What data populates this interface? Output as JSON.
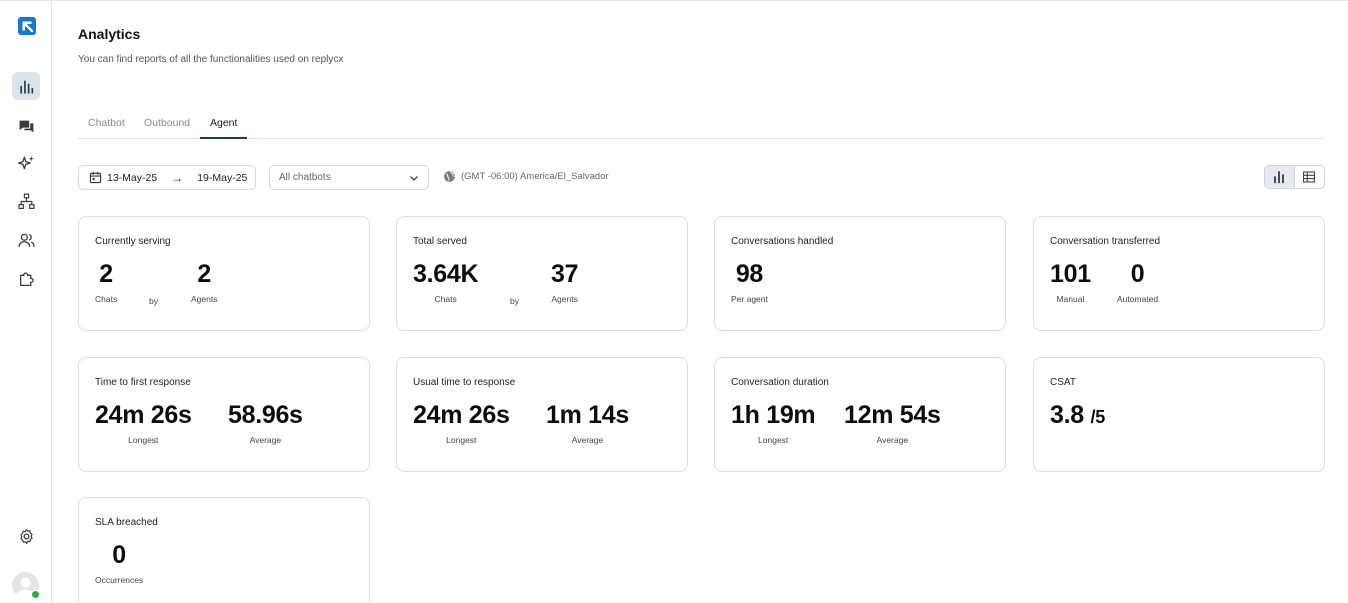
{
  "app": {
    "name": "replycx"
  },
  "sidebar": {
    "items": [
      {
        "name": "analytics",
        "icon": "bar-chart-icon",
        "active": true
      },
      {
        "name": "conversations",
        "icon": "chat-icon"
      },
      {
        "name": "ai",
        "icon": "sparkles-icon"
      },
      {
        "name": "flows",
        "icon": "sitemap-icon"
      },
      {
        "name": "users",
        "icon": "users-icon"
      },
      {
        "name": "integrations",
        "icon": "puzzle-icon"
      }
    ],
    "bottom": [
      {
        "name": "settings",
        "icon": "gear-icon"
      },
      {
        "name": "profile",
        "icon": "avatar-icon",
        "status": "online"
      }
    ]
  },
  "header": {
    "title": "Analytics",
    "subtitle": "You can find reports of all the functionalities used on replycx"
  },
  "tabs": [
    {
      "label": "Chatbot",
      "active": false
    },
    {
      "label": "Outbound",
      "active": false
    },
    {
      "label": "Agent",
      "active": true
    }
  ],
  "filters": {
    "date_from": "13-May-25",
    "date_to": "19-May-25",
    "chatbot_select": "All chatbots",
    "timezone": "(GMT -06:00) America/El_Salvador",
    "view_mode": "chart"
  },
  "cards": {
    "currently_serving": {
      "title": "Currently serving",
      "chats": "2",
      "chats_label": "Chats",
      "by": "by",
      "agents": "2",
      "agents_label": "Agents"
    },
    "total_served": {
      "title": "Total served",
      "chats": "3.64K",
      "chats_label": "Chats",
      "by": "by",
      "agents": "37",
      "agents_label": "Agents"
    },
    "conversations_handled": {
      "title": "Conversations handled",
      "value": "98",
      "label": "Per agent"
    },
    "conversation_transferred": {
      "title": "Conversation transferred",
      "manual": "101",
      "manual_label": "Manual",
      "automated": "0",
      "automated_label": "Automated"
    },
    "time_first_response": {
      "title": "Time to first response",
      "longest": "24m 26s",
      "longest_label": "Longest",
      "average": "58.96s",
      "average_label": "Average"
    },
    "usual_time_response": {
      "title": "Usual time to response",
      "longest": "24m 26s",
      "longest_label": "Longest",
      "average": "1m 14s",
      "average_label": "Average"
    },
    "conversation_duration": {
      "title": "Conversation duration",
      "longest": "1h 19m",
      "longest_label": "Longest",
      "average": "12m 54s",
      "average_label": "Average"
    },
    "csat": {
      "title": "CSAT",
      "value": "3.8",
      "scale": "/5"
    },
    "sla_breached": {
      "title": "SLA breached",
      "value": "0",
      "label": "Occurrences"
    }
  },
  "colors": {
    "brand": "#1877d2",
    "active_tab_underline": "#1d3a5c",
    "status_online": "#22b14c"
  }
}
